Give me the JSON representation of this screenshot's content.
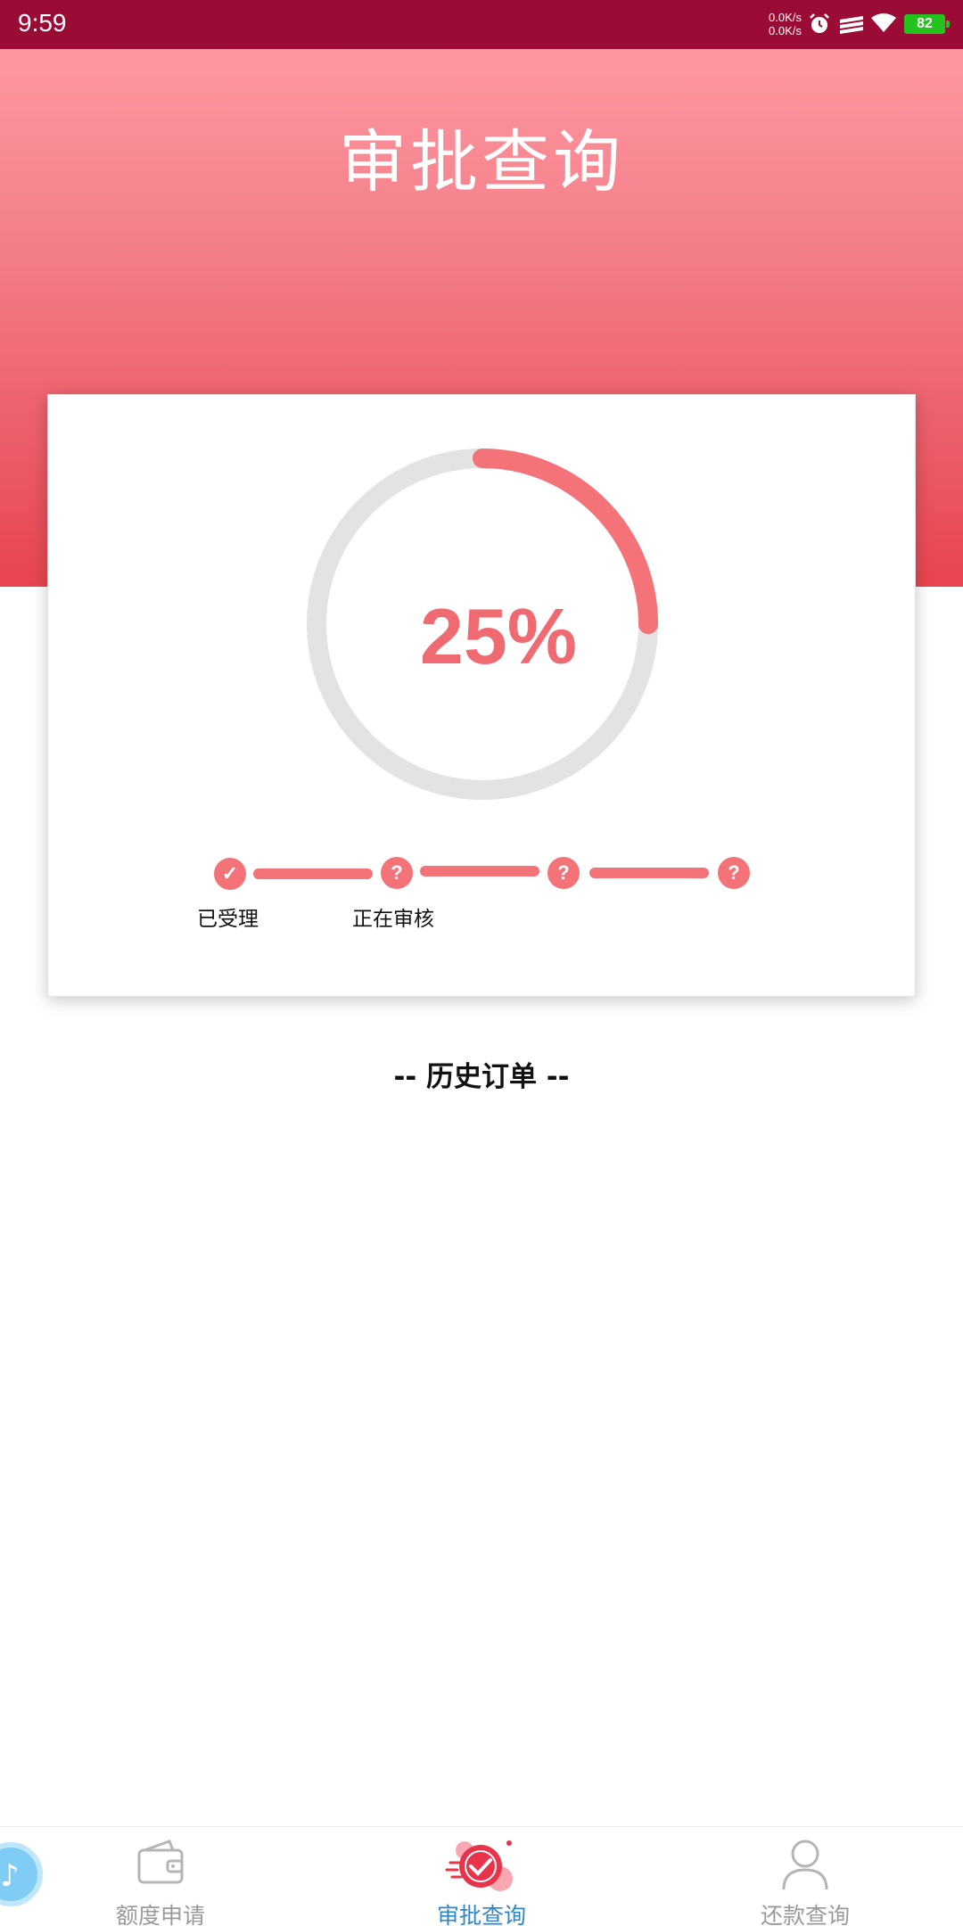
{
  "status_bar": {
    "time": "9:59",
    "net_up": "0.0K/s",
    "net_down": "0.0K/s",
    "battery": "82",
    "icons": [
      "alarm-icon",
      "signal-icon",
      "wifi-icon",
      "battery-icon"
    ],
    "background": "#9a0b35"
  },
  "header": {
    "title": "审批查询",
    "gradient_top": "#ff97a0",
    "gradient_bottom": "#e8454f"
  },
  "progress": {
    "percent_label": "25%",
    "fraction": 0.25,
    "ring_color": "#f37378",
    "track_color": "#e3e3e3"
  },
  "steps": [
    {
      "label": "已受理",
      "status": "done",
      "icon": "check-icon",
      "glyph": "✓"
    },
    {
      "label": "正在审核",
      "status": "pending",
      "icon": "question-icon",
      "glyph": "?"
    },
    {
      "label": "",
      "status": "pending",
      "icon": "question-icon",
      "glyph": "?"
    },
    {
      "label": "",
      "status": "pending",
      "icon": "question-icon",
      "glyph": "?"
    }
  ],
  "history": {
    "title": "-- 历史订单 --"
  },
  "bottom_nav": {
    "items": [
      {
        "label": "额度申请",
        "icon": "wallet-icon",
        "active": false
      },
      {
        "label": "审批查询",
        "icon": "approval-check-icon",
        "active": true
      },
      {
        "label": "还款查询",
        "icon": "user-icon",
        "active": false
      }
    ],
    "active_color": "#2e86c8",
    "inactive_color": "#9a9a9a"
  },
  "floating_ball": {
    "icon": "music-note-icon",
    "glyph": "♪"
  }
}
